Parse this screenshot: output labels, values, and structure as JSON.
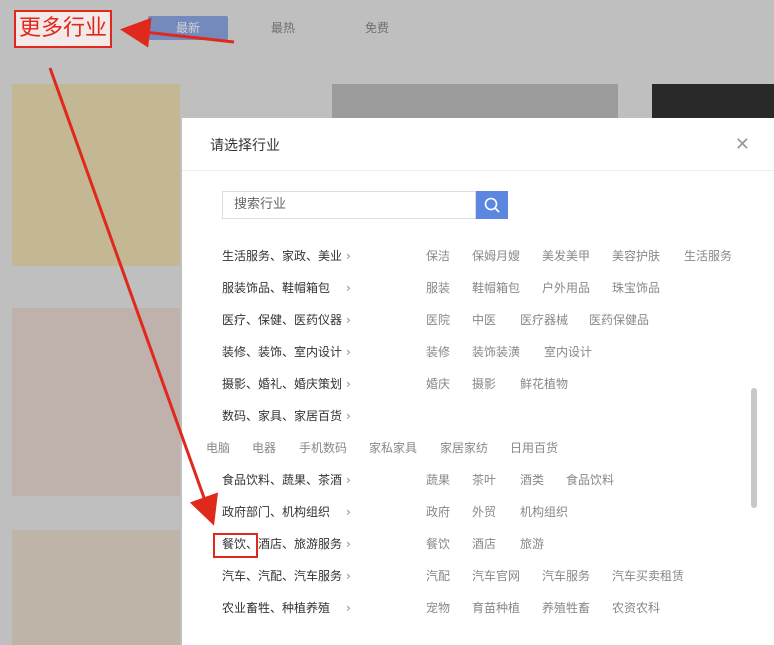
{
  "background": {
    "tabs": [
      "最新",
      "最热",
      "免费"
    ],
    "more_label": "更多行业"
  },
  "modal": {
    "title": "请选择行业",
    "search_placeholder": "搜索行业",
    "rows": [
      {
        "category": "生活服务、家政、美业",
        "subs": [
          "保洁",
          "保姆月嫂",
          "美发美甲",
          "美容护肤",
          "生活服务"
        ]
      },
      {
        "category": "服装饰品、鞋帽箱包",
        "subs": [
          "服装",
          "鞋帽箱包",
          "户外用品",
          "珠宝饰品"
        ]
      },
      {
        "category": "医疗、保健、医药仪器",
        "subs": [
          "医院",
          "中医",
          "医疗器械",
          "医药保健品"
        ]
      },
      {
        "category": "装修、装饰、室内设计",
        "subs": [
          "装修",
          "装饰装潢",
          "室内设计"
        ]
      },
      {
        "category": "摄影、婚礼、婚庆策划",
        "subs": [
          "婚庆",
          "摄影",
          "鲜花植物"
        ]
      },
      {
        "category": "数码、家具、家居百货",
        "subs": []
      },
      {
        "category": "",
        "subs": [
          "电脑",
          "电器",
          "手机数码",
          "家私家具",
          "家居家纺",
          "日用百货"
        ]
      },
      {
        "category": "食品饮料、蔬果、茶酒",
        "subs": [
          "蔬果",
          "茶叶",
          "酒类",
          "食品饮料"
        ]
      },
      {
        "category": "政府部门、机构组织",
        "subs": [
          "政府",
          "外贸",
          "机构组织"
        ]
      },
      {
        "category": "餐饮、酒店、旅游服务",
        "subs": [
          "餐饮",
          "酒店",
          "旅游"
        ]
      },
      {
        "category": "汽车、汽配、汽车服务",
        "subs": [
          "汽配",
          "汽车官网",
          "汽车服务",
          "汽车买卖租赁"
        ]
      },
      {
        "category": "农业畜牲、种植养殖",
        "subs": [
          "宠物",
          "育苗种植",
          "养殖牲畜",
          "农资农科"
        ]
      }
    ]
  }
}
